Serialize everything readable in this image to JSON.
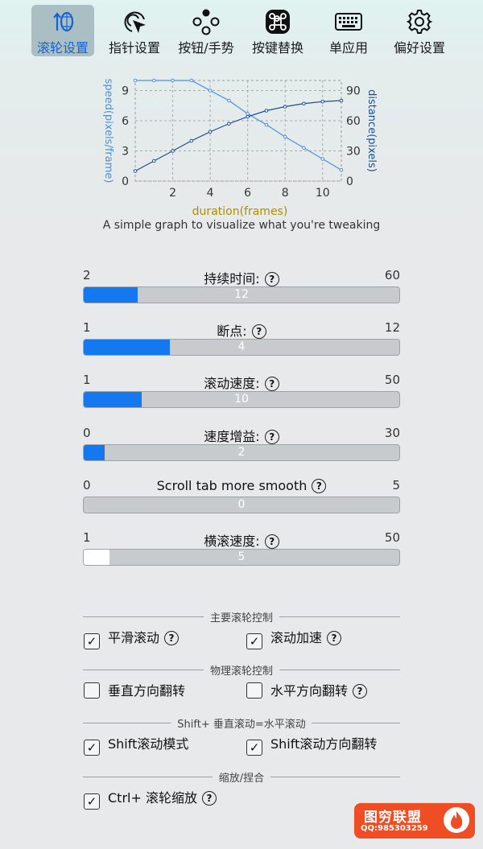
{
  "toolbar": {
    "items": [
      {
        "label": "滚轮设置",
        "icon": "scroll-wheel-icon",
        "active": true
      },
      {
        "label": "指针设置",
        "icon": "pointer-icon",
        "active": false
      },
      {
        "label": "按钮/手势",
        "icon": "buttons-icon",
        "active": false
      },
      {
        "label": "按键替换",
        "icon": "command-key-icon",
        "active": false
      },
      {
        "label": "单应用",
        "icon": "keyboard-icon",
        "active": false
      },
      {
        "label": "偏好设置",
        "icon": "gear-icon",
        "active": false
      }
    ],
    "active_color": "#1463d6"
  },
  "graph": {
    "caption": "A simple graph to visualize what you're tweaking",
    "chart_data": {
      "type": "line",
      "xlabel": "duration(frames)",
      "ylabel_left": "speed(pixels/frame)",
      "ylabel_right": "distance(pixels)",
      "x_ticks": [
        "2",
        "4",
        "6",
        "8",
        "10"
      ],
      "y_left_ticks": [
        "0",
        "3",
        "6",
        "9"
      ],
      "y_right_ticks": [
        "0",
        "30",
        "60",
        "90"
      ],
      "xlim": [
        0,
        11
      ],
      "ylim_left": [
        0,
        10
      ],
      "ylim_right": [
        0,
        100
      ],
      "grid": true,
      "series": [
        {
          "axis": "left",
          "x": [
            0,
            1,
            2,
            3,
            4,
            5,
            6,
            7,
            8,
            9,
            10,
            11
          ],
          "values": [
            10,
            10,
            10,
            10,
            9,
            8,
            6.7,
            5.6,
            4.4,
            3.3,
            2.2,
            1.1
          ]
        },
        {
          "axis": "right",
          "x": [
            0,
            1,
            2,
            3,
            4,
            5,
            6,
            7,
            8,
            9,
            10,
            11
          ],
          "values": [
            10,
            20,
            30,
            40,
            49,
            57,
            64,
            70,
            74,
            77,
            79,
            80
          ]
        }
      ],
      "colors": {
        "speed": "#4a90e2",
        "distance": "#1f4f93",
        "xlabel": "#b08d00"
      }
    }
  },
  "sliders": [
    {
      "name": "duration",
      "label": "持续时间:",
      "help": true,
      "min": "2",
      "max": "60",
      "value": "12",
      "fraction": 0.172,
      "fill": "blue"
    },
    {
      "name": "breakpoint",
      "label": "断点:",
      "help": true,
      "min": "1",
      "max": "12",
      "value": "4",
      "fraction": 0.273,
      "fill": "blue"
    },
    {
      "name": "scroll-speed",
      "label": "滚动速度:",
      "help": true,
      "min": "1",
      "max": "50",
      "value": "10",
      "fraction": 0.184,
      "fill": "blue"
    },
    {
      "name": "speed-gain",
      "label": "速度增益:",
      "help": true,
      "min": "0",
      "max": "30",
      "value": "2",
      "fraction": 0.067,
      "fill": "blue"
    },
    {
      "name": "scroll-tab-smooth",
      "label": "Scroll tab more smooth",
      "help": true,
      "min": "0",
      "max": "5",
      "value": "0",
      "fraction": 0,
      "fill": "blue"
    },
    {
      "name": "horizontal-speed",
      "label": "横滚速度:",
      "help": true,
      "min": "1",
      "max": "50",
      "value": "5",
      "fraction": 0.082,
      "fill": "white"
    }
  ],
  "sections": [
    {
      "title": "主要滚轮控制",
      "options": [
        {
          "label": "平滑滚动",
          "checked": true,
          "help": true
        },
        {
          "label": "滚动加速",
          "checked": true,
          "help": true
        }
      ]
    },
    {
      "title": "物理滚轮控制",
      "options": [
        {
          "label": "垂直方向翻转",
          "checked": false,
          "help": false
        },
        {
          "label": "水平方向翻转",
          "checked": false,
          "help": true
        }
      ]
    },
    {
      "title": "Shift+ 垂直滚动=水平滚动",
      "options": [
        {
          "label": "Shift滚动模式",
          "checked": true,
          "help": false
        },
        {
          "label": "Shift滚动方向翻转",
          "checked": true,
          "help": false
        }
      ]
    },
    {
      "title": "缩放/捏合",
      "options": [
        {
          "label": "Ctrl+ 滚轮缩放",
          "checked": true,
          "help": true
        }
      ]
    }
  ],
  "help_glyph": "?",
  "check_glyph": "✓",
  "watermark": {
    "main": "图穷联盟",
    "sub": "QQ:985303259",
    "color": "#ef4d23"
  }
}
